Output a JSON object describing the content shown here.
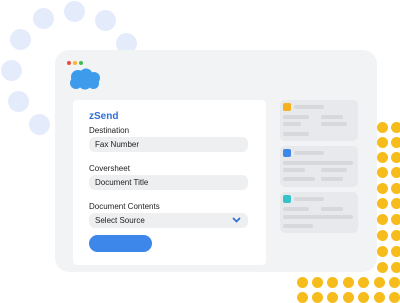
{
  "app": {
    "title": "zSend",
    "logo_icon": "salesforce-cloud-icon",
    "logo_color": "#3d9bec",
    "traffic_colors": [
      "#ef4b3c",
      "#f5b52e",
      "#3fbd52"
    ]
  },
  "form": {
    "destination": {
      "label": "Destination",
      "value": "Fax Number"
    },
    "coversheet": {
      "label": "Coversheet",
      "value": "Document Title"
    },
    "document_contents": {
      "label": "Document Contents",
      "value": "Select Source",
      "icon": "chevron-down-icon"
    },
    "submit_color": "#3d86ea"
  },
  "side_cards": [
    {
      "accent": "#f5b01c"
    },
    {
      "accent": "#3d86ea"
    },
    {
      "accent": "#36c3c8"
    }
  ],
  "decor": {
    "light_dot_color": "#e4ebfb",
    "yellow_dot_color": "#f5bc1c"
  }
}
